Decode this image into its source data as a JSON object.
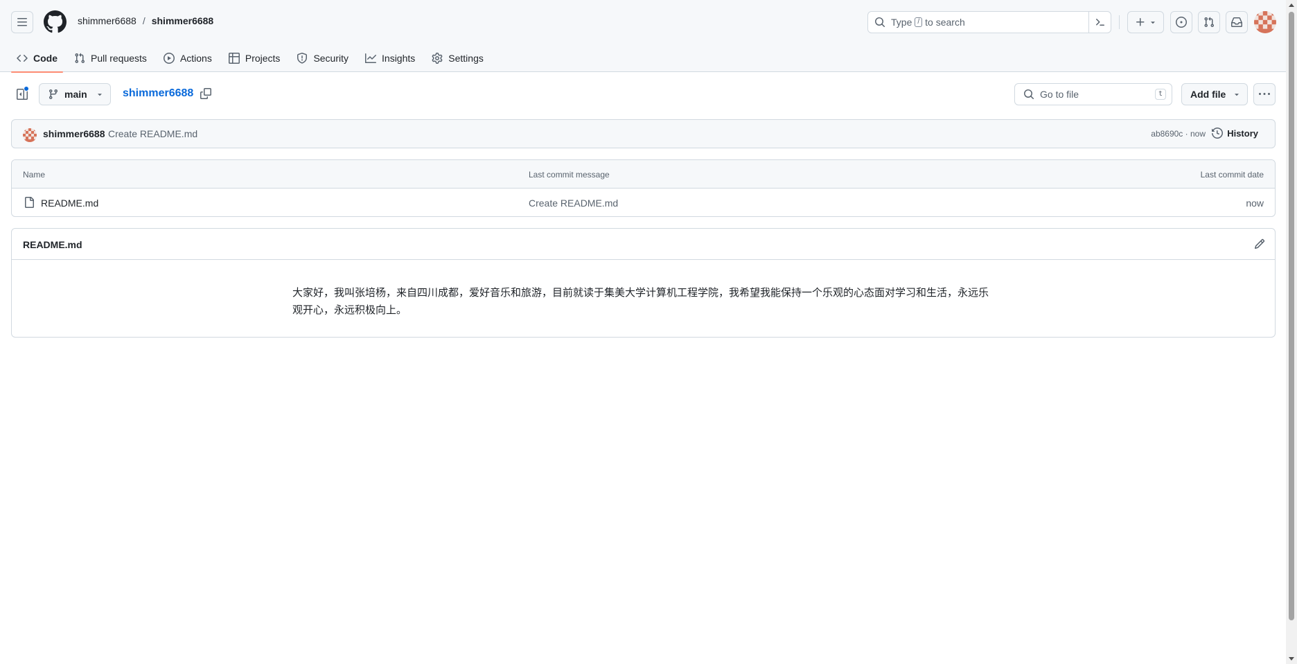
{
  "header": {
    "owner": "shimmer6688",
    "separator": "/",
    "repo": "shimmer6688",
    "search_prefix": "Type",
    "search_key": "/",
    "search_suffix": "to search",
    "plus_label": "+"
  },
  "tabs": [
    {
      "label": "Code",
      "icon": "code-icon",
      "active": true
    },
    {
      "label": "Pull requests",
      "icon": "git-pull-request-icon"
    },
    {
      "label": "Actions",
      "icon": "play-icon"
    },
    {
      "label": "Projects",
      "icon": "table-icon"
    },
    {
      "label": "Security",
      "icon": "shield-icon"
    },
    {
      "label": "Insights",
      "icon": "graph-icon"
    },
    {
      "label": "Settings",
      "icon": "gear-icon"
    }
  ],
  "toolbar": {
    "branch": "main",
    "repo_link": "shimmer6688",
    "goto_placeholder": "Go to file",
    "goto_shortcut": "t",
    "add_file": "Add file"
  },
  "latest_commit": {
    "author": "shimmer6688",
    "message": "Create README.md",
    "meta": "ab8690c · now",
    "history": "History"
  },
  "file_table": {
    "columns": [
      "Name",
      "Last commit message",
      "Last commit date"
    ],
    "rows": [
      {
        "name": "README.md",
        "message": "Create README.md",
        "date": "now"
      }
    ]
  },
  "readme": {
    "title": "README.md",
    "content": "大家好，我叫张培杨，来自四川成都，爱好音乐和旅游，目前就读于集美大学计算机工程学院，我希望我能保持一个乐观的心态面对学习和生活，永远乐观开心，永远积极向上。"
  },
  "colors": {
    "accent": "#0969da",
    "tab_underline": "#fd8c73",
    "border": "#d1d9e0",
    "muted": "#59636e"
  }
}
